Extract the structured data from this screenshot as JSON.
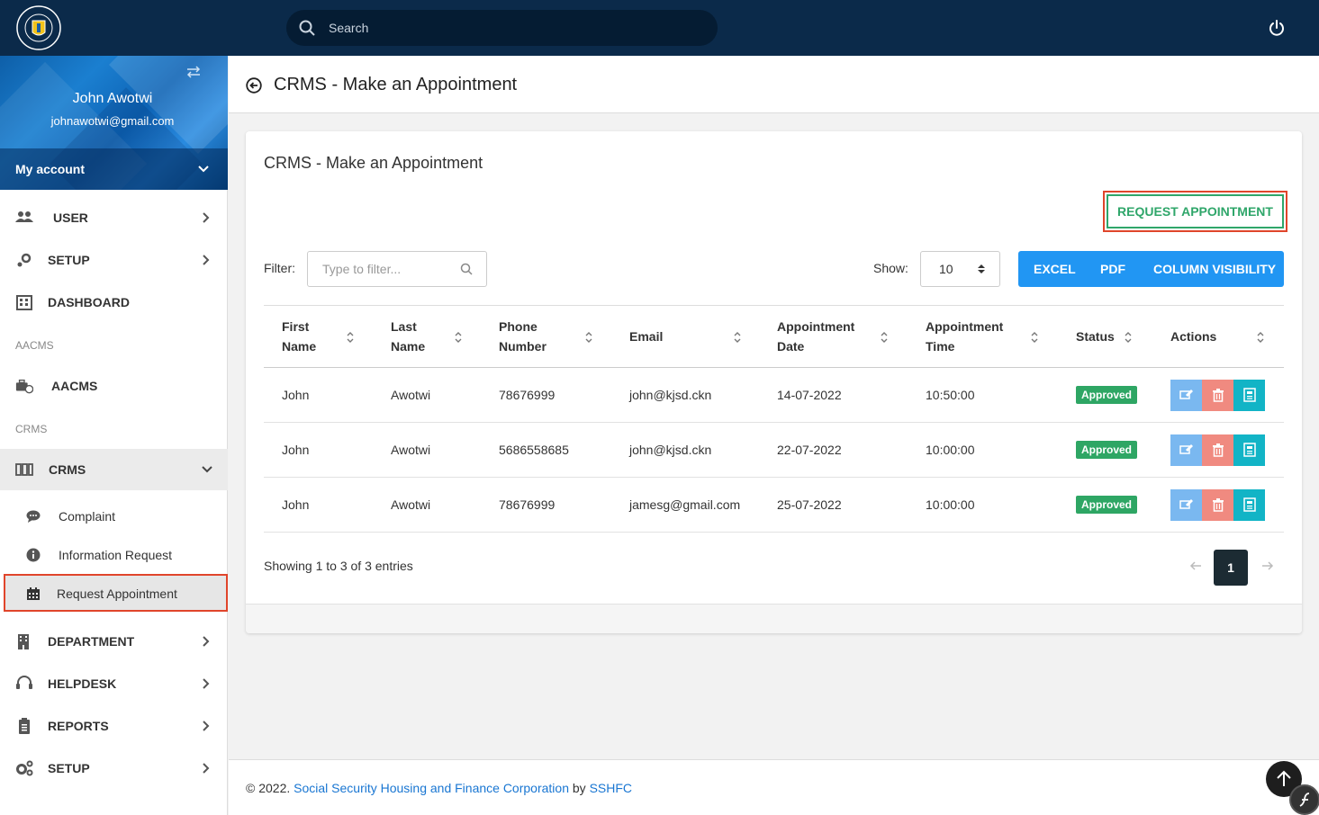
{
  "header": {
    "search_placeholder": "Search",
    "logo_alt": "Social Security Housing Finance Corporation"
  },
  "profile": {
    "name": "John Awotwi",
    "email": "johnawotwi@gmail.com",
    "account_label": "My account"
  },
  "sidebar": {
    "items": [
      {
        "label": "USER"
      },
      {
        "label": "SETUP"
      },
      {
        "label": "DASHBOARD"
      },
      {
        "label": "AACMS"
      },
      {
        "label": "CRMS"
      },
      {
        "label": "DEPARTMENT"
      },
      {
        "label": "HELPDESK"
      },
      {
        "label": "REPORTS"
      },
      {
        "label": "SETUP"
      }
    ],
    "sections": [
      "AACMS",
      "CRMS"
    ],
    "crms_sub": [
      {
        "label": "Complaint"
      },
      {
        "label": "Information Request"
      },
      {
        "label": "Request Appointment"
      }
    ]
  },
  "page": {
    "title": "CRMS - Make an Appointment",
    "card_title": "CRMS - Make an Appointment",
    "request_button": "REQUEST APPOINTMENT",
    "filter_label": "Filter:",
    "filter_placeholder": "Type to filter...",
    "show_label": "Show:",
    "show_value": "10",
    "export_buttons": [
      "EXCEL",
      "PDF",
      "COLUMN VISIBILITY"
    ]
  },
  "table": {
    "headers": [
      [
        "First",
        "Name"
      ],
      [
        "Last",
        "Name"
      ],
      [
        "Phone",
        "Number"
      ],
      [
        "Email"
      ],
      [
        "Appointment",
        "Date"
      ],
      [
        "Appointment",
        "Time"
      ],
      [
        "Status"
      ],
      [
        "Actions"
      ]
    ],
    "rows": [
      {
        "first": "John",
        "last": "Awotwi",
        "phone": "78676999",
        "email": "john@kjsd.ckn",
        "date": "14-07-2022",
        "time": "10:50:00",
        "status": "Approved"
      },
      {
        "first": "John",
        "last": "Awotwi",
        "phone": "5686558685",
        "email": "john@kjsd.ckn",
        "date": "22-07-2022",
        "time": "10:00:00",
        "status": "Approved"
      },
      {
        "first": "John",
        "last": "Awotwi",
        "phone": "78676999",
        "email": "jamesg@gmail.com",
        "date": "25-07-2022",
        "time": "10:00:00",
        "status": "Approved"
      }
    ],
    "showing": "Showing 1 to 3 of 3 entries",
    "current_page": "1"
  },
  "footer": {
    "prefix": "© 2022. ",
    "org": "Social Security Housing and Finance Corporation",
    "by": " by ",
    "brand": "SSHFC"
  },
  "colors": {
    "topbar": "#0b2a4a",
    "primary": "#2196f3",
    "success": "#2ea664",
    "highlight": "#e0452b"
  }
}
